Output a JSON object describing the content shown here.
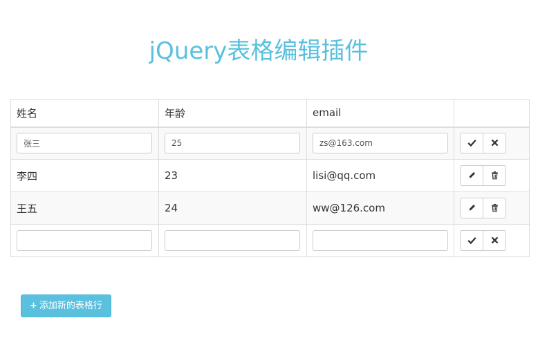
{
  "page": {
    "title": "jQuery表格编辑插件"
  },
  "table": {
    "headers": {
      "name": "姓名",
      "age": "年龄",
      "email": "email",
      "actions": ""
    },
    "rows": [
      {
        "mode": "edit",
        "name": "张三",
        "age": "25",
        "email": "zs@163.com"
      },
      {
        "mode": "view",
        "name": "李四",
        "age": "23",
        "email": "lisi@qq.com"
      },
      {
        "mode": "view",
        "name": "王五",
        "age": "24",
        "email": "ww@126.com"
      },
      {
        "mode": "edit",
        "name": "",
        "age": "",
        "email": ""
      }
    ]
  },
  "icons": {
    "confirm": "check-icon",
    "cancel": "close-icon",
    "edit": "pencil-icon",
    "delete": "trash-icon",
    "add": "plus-icon"
  },
  "add_button": {
    "icon": "+",
    "label": "添加新的表格行"
  },
  "colors": {
    "accent": "#5bc0de",
    "border": "#dddddd",
    "stripe": "#f9f9f9"
  }
}
